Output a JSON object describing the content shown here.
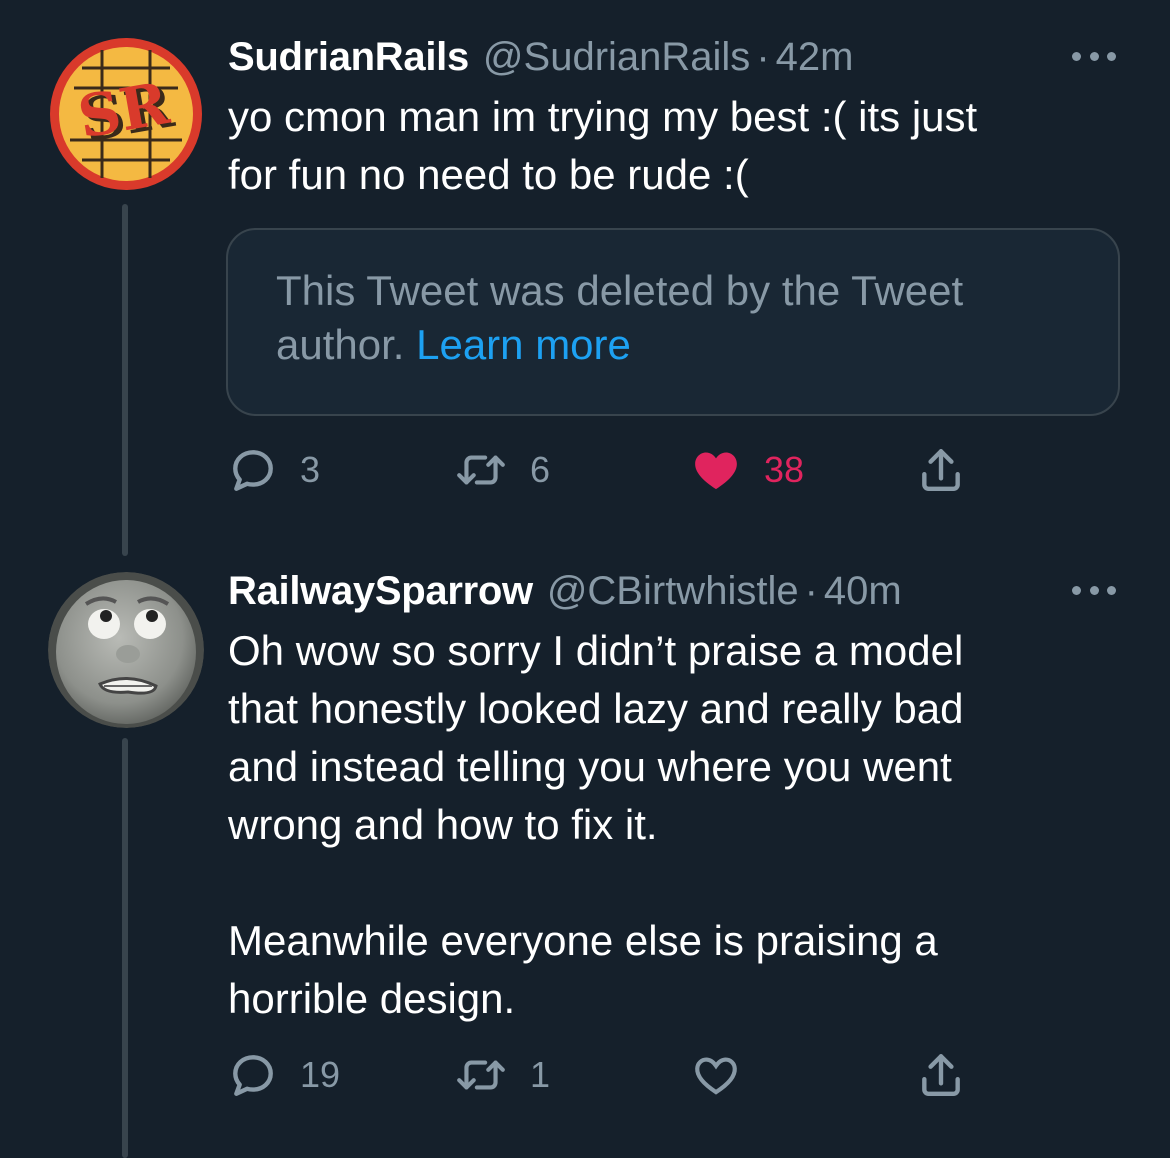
{
  "colors": {
    "background": "#15202b",
    "text_primary": "#ffffff",
    "text_secondary": "#8899a6",
    "link": "#1da1f2",
    "like_active": "#e0245e",
    "divider": "#38444d"
  },
  "tweets": [
    {
      "display_name": "SudrianRails",
      "handle": "@SudrianRails",
      "separator": "·",
      "time": "42m",
      "avatar_text": "SR",
      "text": "yo cmon man im trying my best :( its just\nfor fun no need to be rude :(",
      "quoted": {
        "text": "This Tweet was deleted by the Tweet author. ",
        "link": "Learn more"
      },
      "replies": "3",
      "retweets": "6",
      "likes": "38",
      "liked": true,
      "icons": [
        "reply-icon",
        "retweet-icon",
        "heart-filled-icon",
        "share-icon",
        "more-icon"
      ]
    },
    {
      "display_name": "RailwaySparrow",
      "handle": "@CBirtwhistle",
      "separator": "·",
      "time": "40m",
      "text": "Oh wow so sorry I didn’t praise a model\nthat honestly looked lazy and really bad\nand instead telling you where you went\nwrong and how to fix it.\n\nMeanwhile everyone else is praising a\nhorrible design.",
      "replies": "19",
      "retweets": "1",
      "likes": "",
      "liked": false,
      "icons": [
        "reply-icon",
        "retweet-icon",
        "heart-outline-icon",
        "share-icon",
        "more-icon"
      ]
    }
  ]
}
